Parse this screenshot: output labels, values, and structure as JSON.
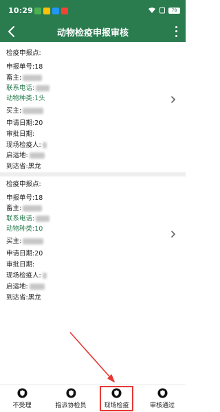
{
  "status_bar": {
    "time": "10:29",
    "battery": "78",
    "notification_colors": [
      "#4caf50",
      "#ffc107",
      "#2196f3",
      "#f44336"
    ]
  },
  "header": {
    "title": "动物检疫申报审核"
  },
  "cards": [
    {
      "fields": [
        {
          "label": "检疫申报点:",
          "value": ""
        },
        {
          "label": "申报单号:",
          "value": "18"
        },
        {
          "label": "畜主:",
          "value": ""
        },
        {
          "label": "联系电话:",
          "value": ""
        },
        {
          "label": "动物种类:",
          "value": "1头"
        },
        {
          "label": "买主:",
          "value": ""
        },
        {
          "label": "申请日期:",
          "value": "20"
        },
        {
          "label": "审批日期:",
          "value": ""
        },
        {
          "label": "现场检疫人:",
          "value": ""
        },
        {
          "label": "启运地:",
          "value": ""
        },
        {
          "label": "到达省:",
          "value": "黑龙"
        }
      ]
    },
    {
      "fields": [
        {
          "label": "检疫申报点:",
          "value": ""
        },
        {
          "label": "申报单号:",
          "value": "18"
        },
        {
          "label": "畜主:",
          "value": ""
        },
        {
          "label": "联系电话:",
          "value": ""
        },
        {
          "label": "动物种类:",
          "value": "10"
        },
        {
          "label": "买主:",
          "value": ""
        },
        {
          "label": "申请日期:",
          "value": "20"
        },
        {
          "label": "审批日期:",
          "value": ""
        },
        {
          "label": "现场检疫人:",
          "value": ""
        },
        {
          "label": "启运地:",
          "value": ""
        },
        {
          "label": "到达省:",
          "value": "黑龙"
        }
      ]
    }
  ],
  "bottom_bar": {
    "tabs": [
      {
        "label": "不受理",
        "icon": "shield-icon"
      },
      {
        "label": "指派协检员",
        "icon": "shield-icon"
      },
      {
        "label": "现场检疫",
        "icon": "shield-icon"
      },
      {
        "label": "审核通过",
        "icon": "shield-icon"
      }
    ],
    "highlighted_tab": "现场检疫"
  },
  "colors": {
    "primary": "#2a7c4f",
    "annotation": "#e53935",
    "label_dark": "#222222",
    "label_green": "#2a7c4f"
  }
}
